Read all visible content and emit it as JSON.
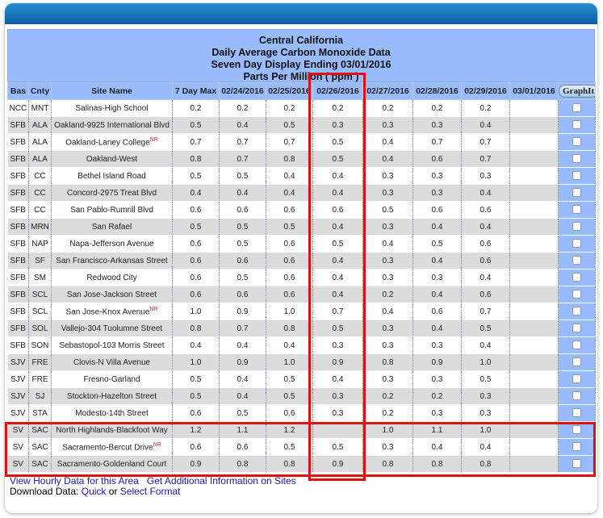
{
  "header": {
    "line1": "Central California",
    "line2": "Daily Average Carbon Monoxide Data",
    "line3": "Seven Day Display Ending 03/01/2016",
    "line4": "Parts Per Million ( ppm )"
  },
  "columns": [
    "Bas",
    "Cnty",
    "Site Name",
    "7 Day Max",
    "02/24/2016",
    "02/25/2016",
    "02/26/2016",
    "02/27/2016",
    "02/28/2016",
    "02/29/2016",
    "03/01/2016"
  ],
  "graph_button_label": "GraphIt",
  "rows": [
    {
      "bas": "NCC",
      "cnty": "MNT",
      "site": "Salinas-High School",
      "nr": "",
      "max": "0.2",
      "v": [
        "0.2",
        "0.2",
        "0.2",
        "0.2",
        "0.2",
        "0.2",
        ""
      ]
    },
    {
      "bas": "SFB",
      "cnty": "ALA",
      "site": "Oakland-9925 International Blvd",
      "nr": "",
      "max": "0.5",
      "v": [
        "0.4",
        "0.5",
        "0.3",
        "0.3",
        "0.3",
        "0.4",
        ""
      ]
    },
    {
      "bas": "SFB",
      "cnty": "ALA",
      "site": "Oakland-Laney College",
      "nr": "NR",
      "max": "0.7",
      "v": [
        "0.7",
        "0.7",
        "0.5",
        "0.4",
        "0.7",
        "0.7",
        ""
      ]
    },
    {
      "bas": "SFB",
      "cnty": "ALA",
      "site": "Oakland-West",
      "nr": "",
      "max": "0.8",
      "v": [
        "0.7",
        "0.8",
        "0.5",
        "0.4",
        "0.6",
        "0.7",
        ""
      ]
    },
    {
      "bas": "SFB",
      "cnty": "CC",
      "site": "Bethel Island Road",
      "nr": "",
      "max": "0.5",
      "v": [
        "0.5",
        "0.4",
        "0.4",
        "0.3",
        "0.3",
        "0.3",
        ""
      ]
    },
    {
      "bas": "SFB",
      "cnty": "CC",
      "site": "Concord-2975 Treat Blvd",
      "nr": "",
      "max": "0.4",
      "v": [
        "0.4",
        "0.4",
        "0.4",
        "0.3",
        "0.3",
        "0.4",
        ""
      ]
    },
    {
      "bas": "SFB",
      "cnty": "CC",
      "site": "San Pablo-Rumrill Blvd",
      "nr": "",
      "max": "0.6",
      "v": [
        "0.6",
        "0.6",
        "0.6",
        "0.5",
        "0.6",
        "0.6",
        ""
      ]
    },
    {
      "bas": "SFB",
      "cnty": "MRN",
      "site": "San Rafael",
      "nr": "",
      "max": "0.5",
      "v": [
        "0.5",
        "0.5",
        "0.4",
        "0.3",
        "0.4",
        "0.4",
        ""
      ]
    },
    {
      "bas": "SFB",
      "cnty": "NAP",
      "site": "Napa-Jefferson Avenue",
      "nr": "",
      "max": "0.6",
      "v": [
        "0.5",
        "0.6",
        "0.5",
        "0.4",
        "0.5",
        "0.6",
        ""
      ]
    },
    {
      "bas": "SFB",
      "cnty": "SF",
      "site": "San Francisco-Arkansas Street",
      "nr": "",
      "max": "0.6",
      "v": [
        "0.6",
        "0.6",
        "0.4",
        "0.3",
        "0.4",
        "0.6",
        ""
      ]
    },
    {
      "bas": "SFB",
      "cnty": "SM",
      "site": "Redwood City",
      "nr": "",
      "max": "0.6",
      "v": [
        "0.5",
        "0.6",
        "0.4",
        "0.3",
        "0.3",
        "0.4",
        ""
      ]
    },
    {
      "bas": "SFB",
      "cnty": "SCL",
      "site": "San Jose-Jackson Street",
      "nr": "",
      "max": "0.6",
      "v": [
        "0.6",
        "0.6",
        "0.4",
        "0.2",
        "0.4",
        "0.6",
        ""
      ]
    },
    {
      "bas": "SFB",
      "cnty": "SCL",
      "site": "San Jose-Knox Avenue",
      "nr": "NR",
      "max": "1.0",
      "v": [
        "0.9",
        "1.0",
        "0.7",
        "0.4",
        "0.6",
        "0.7",
        ""
      ]
    },
    {
      "bas": "SFB",
      "cnty": "SOL",
      "site": "Vallejo-304 Tuolumne Street",
      "nr": "",
      "max": "0.8",
      "v": [
        "0.7",
        "0.8",
        "0.5",
        "0.3",
        "0.4",
        "0.5",
        ""
      ]
    },
    {
      "bas": "SFB",
      "cnty": "SON",
      "site": "Sebastopol-103 Morris Street",
      "nr": "",
      "max": "0.4",
      "v": [
        "0.4",
        "0.4",
        "0.3",
        "0.3",
        "0.3",
        "0.4",
        ""
      ]
    },
    {
      "bas": "SJV",
      "cnty": "FRE",
      "site": "Clovis-N Villa Avenue",
      "nr": "",
      "max": "1.0",
      "v": [
        "0.9",
        "1.0",
        "0.9",
        "0.8",
        "0.9",
        "1.0",
        ""
      ]
    },
    {
      "bas": "SJV",
      "cnty": "FRE",
      "site": "Fresno-Garland",
      "nr": "",
      "max": "0.5",
      "v": [
        "0.4",
        "0.5",
        "0.4",
        "0.3",
        "0.3",
        "0.5",
        ""
      ]
    },
    {
      "bas": "SJV",
      "cnty": "SJ",
      "site": "Stockton-Hazelton Street",
      "nr": "",
      "max": "0.5",
      "v": [
        "0.4",
        "0.5",
        "0.3",
        "0.2",
        "0.2",
        "0.3",
        ""
      ]
    },
    {
      "bas": "SJV",
      "cnty": "STA",
      "site": "Modesto-14th Street",
      "nr": "",
      "max": "0.6",
      "v": [
        "0.5",
        "0.6",
        "0.3",
        "0.2",
        "0.3",
        "0.3",
        ""
      ]
    },
    {
      "bas": "SV",
      "cnty": "SAC",
      "site": "North Highlands-Blackfoot Way",
      "nr": "",
      "max": "1.2",
      "v": [
        "1.1",
        "1.2",
        "",
        "1.0",
        "1.1",
        "1.0",
        ""
      ],
      "site_gray": true
    },
    {
      "bas": "SV",
      "cnty": "SAC",
      "site": "Sacramento-Bercut Drive",
      "nr": "NR",
      "max": "0.6",
      "v": [
        "0.6",
        "0.5",
        "0.5",
        "0.3",
        "0.4",
        "0.4",
        ""
      ]
    },
    {
      "bas": "SV",
      "cnty": "SAC",
      "site": "Sacramento-Goldenland Court",
      "nr": "",
      "max": "0.9",
      "v": [
        "0.8",
        "0.8",
        "0.9",
        "0.8",
        "0.8",
        "0.8",
        ""
      ]
    }
  ],
  "footer": {
    "hourly_link": "View Hourly Data for this Area",
    "additional_link": "Get Additional Information on Sites",
    "download_label": "Download Data:",
    "quick_link": "Quick",
    "or_text": "or",
    "select_format_link": "Select Format"
  },
  "colors": {
    "header_bg": "#99bbff",
    "link": "#1a1aa8",
    "nr_marker": "#e02020",
    "highlight_box": "#dd1111",
    "topbar": "#1a78c2"
  }
}
